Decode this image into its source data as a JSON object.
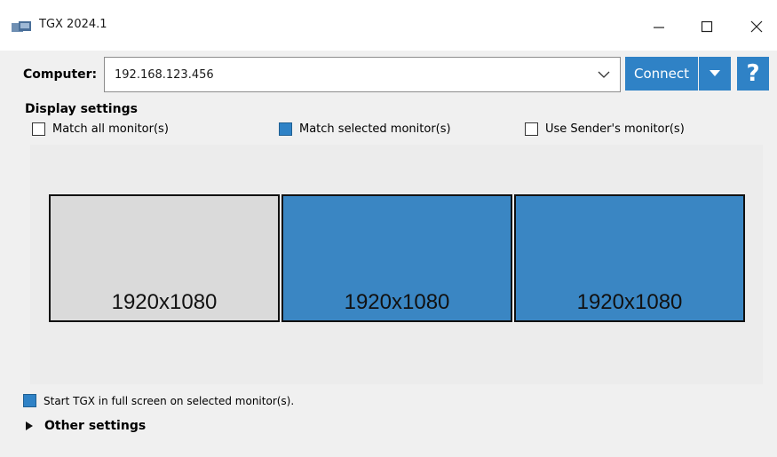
{
  "window": {
    "title": "TGX 2024.1",
    "app_icon": "tgx-app-icon",
    "controls": {
      "minimize_icon": "minimize-icon",
      "maximize_icon": "maximize-icon",
      "close_icon": "close-icon"
    }
  },
  "connection": {
    "computer_label": "Computer:",
    "computer_value": "192.168.123.456",
    "connect_label": "Connect",
    "help_label": "?"
  },
  "display_settings": {
    "title": "Display settings",
    "options": [
      {
        "label": "Match all monitor(s)",
        "checked": false
      },
      {
        "label": "Match selected monitor(s)",
        "checked": true
      },
      {
        "label": "Use Sender's monitor(s)",
        "checked": false
      }
    ],
    "monitors": [
      {
        "resolution": "1920x1080",
        "selected": false
      },
      {
        "resolution": "1920x1080",
        "selected": true
      },
      {
        "resolution": "1920x1080",
        "selected": true
      }
    ]
  },
  "fullscreen": {
    "label": "Start TGX in full screen on selected monitor(s).",
    "checked": true
  },
  "other_settings": {
    "label": "Other settings"
  },
  "colors": {
    "accent": "#2f82c6",
    "monitor_selected": "#3a86c3",
    "monitor_unselected": "#dadada",
    "window_bg": "#f0f0f0"
  }
}
